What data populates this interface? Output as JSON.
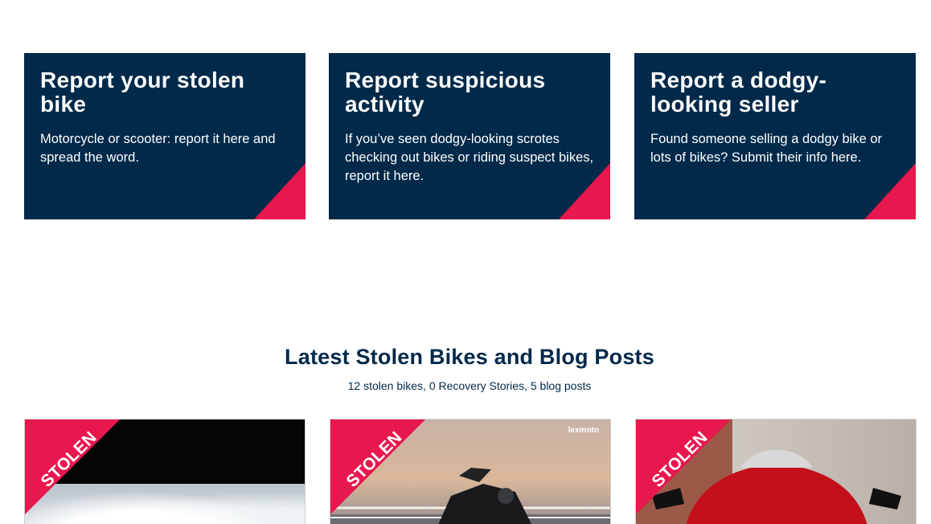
{
  "report_cards": [
    {
      "title": "Report your stolen bike",
      "description": "Motorcycle or scooter: report it here and spread the word."
    },
    {
      "title": "Report suspicious activity",
      "description": "If you’ve seen dodgy-looking scrotes checking out bikes or riding suspect bikes, report it here."
    },
    {
      "title": "Report a dodgy-looking seller",
      "description": "Found someone selling a dodgy bike or lots of bikes? Submit their info here."
    }
  ],
  "latest": {
    "heading": "Latest Stolen Bikes and Blog Posts",
    "stats": "12 stolen bikes, 0 Recovery Stories, 5 blog posts"
  },
  "bike_cards": [
    {
      "badge": "STOLEN"
    },
    {
      "badge": "STOLEN",
      "brand": "lexmoto"
    },
    {
      "badge": "STOLEN"
    }
  ],
  "colors": {
    "navy": "#00294a",
    "accent": "#e8174d"
  }
}
